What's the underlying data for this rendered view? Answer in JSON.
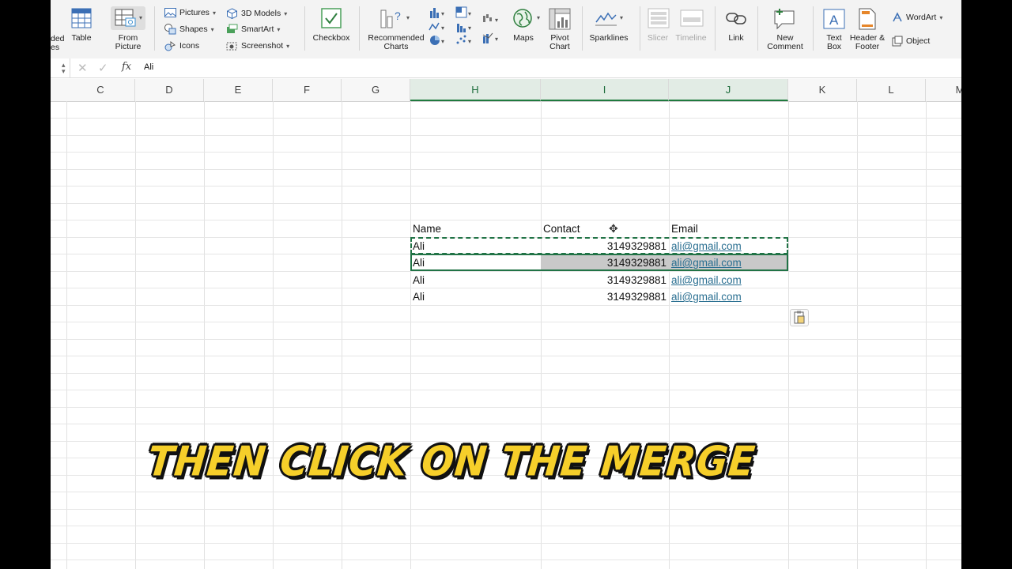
{
  "ribbon": {
    "partial_left": [
      "ded",
      "es"
    ],
    "table": "Table",
    "from_picture": [
      "From",
      "Picture"
    ],
    "pictures": "Pictures",
    "shapes": "Shapes",
    "icons": "Icons",
    "models_3d": "3D Models",
    "smartart": "SmartArt",
    "screenshot": "Screenshot",
    "checkbox": "Checkbox",
    "recommended_charts": [
      "Recommended",
      "Charts"
    ],
    "maps": "Maps",
    "pivot_chart": [
      "Pivot",
      "Chart"
    ],
    "sparklines": "Sparklines",
    "slicer": "Slicer",
    "timeline": "Timeline",
    "link": "Link",
    "new_comment": [
      "New",
      "Comment"
    ],
    "text_box": [
      "Text",
      "Box"
    ],
    "header_footer": [
      "Header &",
      "Footer"
    ],
    "wordart": "WordArt",
    "object": "Object"
  },
  "formula_bar": {
    "fx": "fx",
    "value": "Ali"
  },
  "columns": [
    "C",
    "D",
    "E",
    "F",
    "G",
    "H",
    "I",
    "J",
    "K",
    "L",
    "M"
  ],
  "table": {
    "headers": [
      "Name",
      "Contact",
      "Email"
    ],
    "rows": [
      [
        "Ali",
        "3149329881",
        "ali@gmail.com"
      ],
      [
        "Ali",
        "3149329881",
        "ali@gmail.com"
      ],
      [
        "Ali",
        "3149329881",
        "ali@gmail.com"
      ],
      [
        "Ali",
        "3149329881",
        "ali@gmail.com"
      ]
    ]
  },
  "caption": "THEN CLICK ON THE MERGE",
  "colors": {
    "accent": "#217346",
    "caption": "#f6cf2a",
    "link": "#2a6f91"
  }
}
